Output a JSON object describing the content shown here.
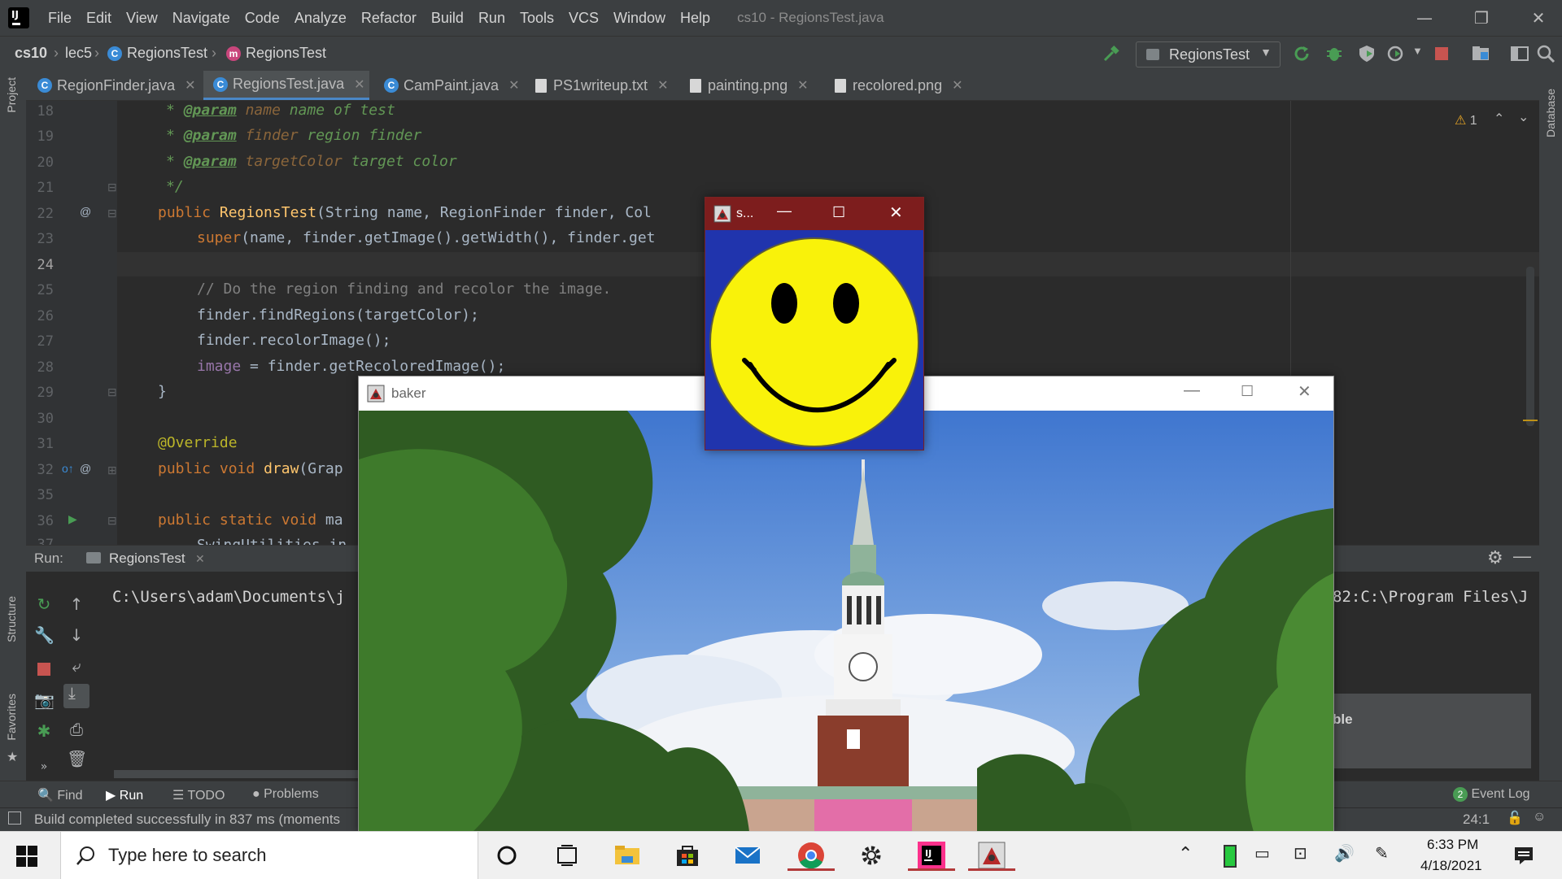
{
  "menu": {
    "items": [
      "File",
      "Edit",
      "View",
      "Navigate",
      "Code",
      "Analyze",
      "Refactor",
      "Build",
      "Run",
      "Tools",
      "VCS",
      "Window",
      "Help"
    ],
    "window_title": "cs10 - RegionsTest.java"
  },
  "navbar": {
    "breadcrumbs": [
      "cs10",
      "lec5",
      "RegionsTest",
      "RegionsTest"
    ],
    "run_config": "RegionsTest"
  },
  "tabs": [
    {
      "label": "RegionFinder.java"
    },
    {
      "label": "RegionsTest.java"
    },
    {
      "label": "CamPaint.java"
    },
    {
      "label": "PS1writeup.txt"
    },
    {
      "label": "painting.png"
    },
    {
      "label": "recolored.png"
    }
  ],
  "side_labels": {
    "project": "Project",
    "structure": "Structure",
    "favorites": "Favorites",
    "database": "Database"
  },
  "editor": {
    "warning_count": "1",
    "lines": [
      "18",
      "19",
      "20",
      "21",
      "22",
      "23",
      "24",
      "25",
      "26",
      "27",
      "28",
      "29",
      "30",
      "31",
      "32",
      "35",
      "36",
      "37"
    ],
    "param_tag": "@param",
    "param1_name": "name",
    "param1_desc": "name of test",
    "param2_name": "finder",
    "param2_desc": "region finder",
    "param3_name": "targetColor",
    "param3_desc": "target color",
    "doc_close": "*/",
    "l22_kw": "public",
    "l22_fn": "RegionsTest",
    "l22_rest": "(String name, RegionFinder finder, Col",
    "l23_kw": "super",
    "l23_rest": "(name, finder.getImage().getWidth(), finder.get",
    "l25": "// Do the region finding and recolor the image.",
    "l26": "finder.findRegions(targetColor);",
    "l27": "finder.recolorImage();",
    "l28_field": "image",
    "l28_rest": " = finder.getRecoloredImage();",
    "l29": "}",
    "l31": "@Override",
    "l32_kw": "public void",
    "l32_fn": "draw",
    "l32_rest": "(Grap",
    "l36_kw": "public static void",
    "l36_rest": "ma",
    "l37": "SwingUtilities.in"
  },
  "run_panel": {
    "label": "Run:",
    "tab": "RegionsTest",
    "console_left": "C:\\Users\\adam\\Documents\\j",
    "console_right": "82:C:\\Program Files\\J",
    "popup_fragment": "ble"
  },
  "bottom_tools": [
    "Find",
    "Run",
    "TODO",
    "Problems"
  ],
  "event_log": {
    "count": "2",
    "label": "Event Log"
  },
  "status": {
    "message": "Build completed successfully in 837 ms (moments",
    "position": "24:1"
  },
  "baker_window": {
    "title": "baker"
  },
  "smiley_window": {
    "title": "s..."
  },
  "taskbar": {
    "search_placeholder": "Type here to search",
    "time": "6:33 PM",
    "date": "4/18/2021"
  },
  "colors": {
    "accent": "#4a88c7",
    "stop": "#c75450",
    "run": "#499c54",
    "smiley_bg": "#2034ad",
    "smiley_title": "#7d1d1d"
  }
}
